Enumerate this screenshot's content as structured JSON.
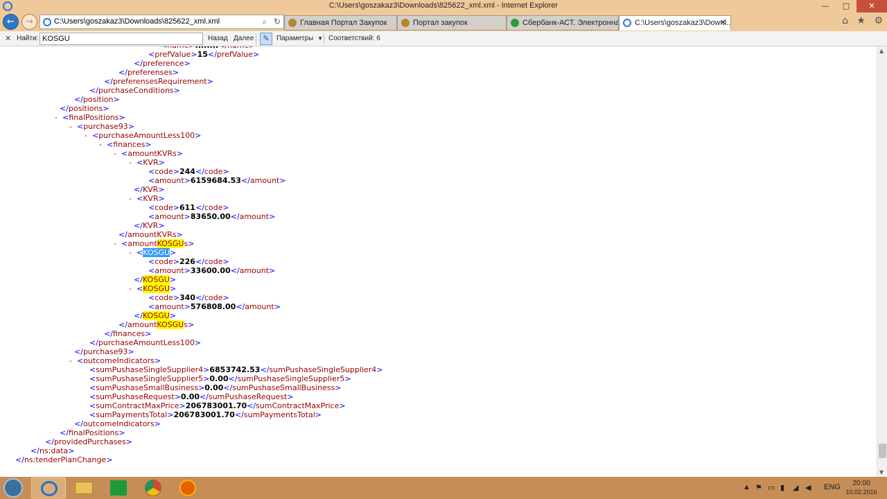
{
  "window": {
    "title": "C:\\Users\\goszakaz3\\Downloads\\825622_xml.xml - Internet Explorer",
    "minimize": "—",
    "maximize": "□",
    "close": "✕"
  },
  "navbar": {
    "back_icon": "←",
    "forward_icon": "→",
    "url": "C:\\Users\\goszakaz3\\Downloads\\825622_xml.xml",
    "search_icon": "⌕",
    "refresh_icon": "↻"
  },
  "tabs": [
    {
      "label": "Главная Портал Закупок",
      "icon": "emblem-icon",
      "color": "#b8872b",
      "active": false
    },
    {
      "label": "Портал закупок",
      "icon": "emblem-icon",
      "color": "#b8872b",
      "active": false
    },
    {
      "label": "Сбербанк-АСТ. Электронная ...",
      "icon": "sberbank-icon",
      "color": "#2a9d3a",
      "active": false
    },
    {
      "label": "C:\\Users\\goszakaz3\\Downl...",
      "icon": "ie-doc-icon",
      "color": "#2b78d4",
      "active": true,
      "close": "✕"
    }
  ],
  "toolbar_icons": {
    "home": "⌂",
    "favorites": "★",
    "settings": "⚙"
  },
  "findbar": {
    "close": "✕",
    "label": "Найти:",
    "query": "KOSGU",
    "prev": "Назад",
    "next": "Далее",
    "options": "Параметры",
    "options_arrow": "▼",
    "matches": "Соответствий: 6"
  },
  "xml_lines": [
    {
      "indent": 29,
      "html": "<span class=\"b\">&lt;</span><span class=\"t\">prefValue</span><span class=\"b\">&gt;</span><span class=\"v\">15</span><span class=\"b\">&lt;/</span><span class=\"t\">prefValue</span><span class=\"b\">&gt;</span>"
    },
    {
      "indent": 26,
      "html": "<span class=\"b\">&lt;/</span><span class=\"t\">preference</span><span class=\"b\">&gt;</span>"
    },
    {
      "indent": 23,
      "html": "<span class=\"b\">&lt;/</span><span class=\"t\">preferenses</span><span class=\"b\">&gt;</span>"
    },
    {
      "indent": 20,
      "html": "<span class=\"b\">&lt;/</span><span class=\"t\">preferensesRequirement</span><span class=\"b\">&gt;</span>"
    },
    {
      "indent": 17,
      "html": "<span class=\"b\">&lt;/</span><span class=\"t\">purchaseConditions</span><span class=\"b\">&gt;</span>"
    },
    {
      "indent": 14,
      "html": "<span class=\"b\">&lt;/</span><span class=\"t\">position</span><span class=\"b\">&gt;</span>"
    },
    {
      "indent": 11,
      "html": "<span class=\"b\">&lt;/</span><span class=\"t\">positions</span><span class=\"b\">&gt;</span>"
    },
    {
      "indent": 10,
      "html": "<span class=\"m\">-</span><span class=\"b\">&lt;</span><span class=\"t\">finalPositions</span><span class=\"b\">&gt;</span>"
    },
    {
      "indent": 13,
      "html": "<span class=\"m\">-</span><span class=\"b\">&lt;</span><span class=\"t\">purchase93</span><span class=\"b\">&gt;</span>"
    },
    {
      "indent": 16,
      "html": "<span class=\"m\">-</span><span class=\"b\">&lt;</span><span class=\"t\">purchaseAmountLess100</span><span class=\"b\">&gt;</span>"
    },
    {
      "indent": 19,
      "html": "<span class=\"m\">-</span><span class=\"b\">&lt;</span><span class=\"t\">finances</span><span class=\"b\">&gt;</span>"
    },
    {
      "indent": 22,
      "html": "<span class=\"m\">-</span><span class=\"b\">&lt;</span><span class=\"t\">amountKVRs</span><span class=\"b\">&gt;</span>"
    },
    {
      "indent": 25,
      "html": "<span class=\"m\">-</span><span class=\"b\">&lt;</span><span class=\"t\">KVR</span><span class=\"b\">&gt;</span>"
    },
    {
      "indent": 29,
      "html": "<span class=\"b\">&lt;</span><span class=\"t\">code</span><span class=\"b\">&gt;</span><span class=\"v\">244</span><span class=\"b\">&lt;/</span><span class=\"t\">code</span><span class=\"b\">&gt;</span>"
    },
    {
      "indent": 29,
      "html": "<span class=\"b\">&lt;</span><span class=\"t\">amount</span><span class=\"b\">&gt;</span><span class=\"v\">6159684.53</span><span class=\"b\">&lt;/</span><span class=\"t\">amount</span><span class=\"b\">&gt;</span>"
    },
    {
      "indent": 26,
      "html": "<span class=\"b\">&lt;/</span><span class=\"t\">KVR</span><span class=\"b\">&gt;</span>"
    },
    {
      "indent": 25,
      "html": "<span class=\"m\">-</span><span class=\"b\">&lt;</span><span class=\"t\">KVR</span><span class=\"b\">&gt;</span>"
    },
    {
      "indent": 29,
      "html": "<span class=\"b\">&lt;</span><span class=\"t\">code</span><span class=\"b\">&gt;</span><span class=\"v\">611</span><span class=\"b\">&lt;/</span><span class=\"t\">code</span><span class=\"b\">&gt;</span>"
    },
    {
      "indent": 29,
      "html": "<span class=\"b\">&lt;</span><span class=\"t\">amount</span><span class=\"b\">&gt;</span><span class=\"v\">83650.00</span><span class=\"b\">&lt;/</span><span class=\"t\">amount</span><span class=\"b\">&gt;</span>"
    },
    {
      "indent": 26,
      "html": "<span class=\"b\">&lt;/</span><span class=\"t\">KVR</span><span class=\"b\">&gt;</span>"
    },
    {
      "indent": 23,
      "html": "<span class=\"b\">&lt;/</span><span class=\"t\">amountKVRs</span><span class=\"b\">&gt;</span>"
    },
    {
      "indent": 22,
      "html": "<span class=\"m\">-</span><span class=\"b\">&lt;</span><span class=\"t\">amount<span class=\"hl\">KOSGU</span>s</span><span class=\"b\">&gt;</span>"
    },
    {
      "indent": 25,
      "html": "<span class=\"m\">-</span><span class=\"b\">&lt;</span><span class=\"t sel\">KOSGU</span><span class=\"b\">&gt;</span>"
    },
    {
      "indent": 29,
      "html": "<span class=\"b\">&lt;</span><span class=\"t\">code</span><span class=\"b\">&gt;</span><span class=\"v\">226</span><span class=\"b\">&lt;/</span><span class=\"t\">code</span><span class=\"b\">&gt;</span>"
    },
    {
      "indent": 29,
      "html": "<span class=\"b\">&lt;</span><span class=\"t\">amount</span><span class=\"b\">&gt;</span><span class=\"v\">33600.00</span><span class=\"b\">&lt;/</span><span class=\"t\">amount</span><span class=\"b\">&gt;</span>"
    },
    {
      "indent": 26,
      "html": "<span class=\"b\">&lt;/</span><span class=\"t hl\">KOSGU</span><span class=\"b\">&gt;</span>"
    },
    {
      "indent": 25,
      "html": "<span class=\"m\">-</span><span class=\"b\">&lt;</span><span class=\"t hl\">KOSGU</span><span class=\"b\">&gt;</span>"
    },
    {
      "indent": 29,
      "html": "<span class=\"b\">&lt;</span><span class=\"t\">code</span><span class=\"b\">&gt;</span><span class=\"v\">340</span><span class=\"b\">&lt;/</span><span class=\"t\">code</span><span class=\"b\">&gt;</span>"
    },
    {
      "indent": 29,
      "html": "<span class=\"b\">&lt;</span><span class=\"t\">amount</span><span class=\"b\">&gt;</span><span class=\"v\">576808.00</span><span class=\"b\">&lt;/</span><span class=\"t\">amount</span><span class=\"b\">&gt;</span>"
    },
    {
      "indent": 26,
      "html": "<span class=\"b\">&lt;/</span><span class=\"t hl\">KOSGU</span><span class=\"b\">&gt;</span>"
    },
    {
      "indent": 23,
      "html": "<span class=\"b\">&lt;/</span><span class=\"t\">amount<span class=\"hl\">KOSGU</span>s</span><span class=\"b\">&gt;</span>"
    },
    {
      "indent": 20,
      "html": "<span class=\"b\">&lt;/</span><span class=\"t\">finances</span><span class=\"b\">&gt;</span>"
    },
    {
      "indent": 17,
      "html": "<span class=\"b\">&lt;/</span><span class=\"t\">purchaseAmountLess100</span><span class=\"b\">&gt;</span>"
    },
    {
      "indent": 14,
      "html": "<span class=\"b\">&lt;/</span><span class=\"t\">purchase93</span><span class=\"b\">&gt;</span>"
    },
    {
      "indent": 13,
      "html": "<span class=\"m\">-</span><span class=\"b\">&lt;</span><span class=\"t\">outcomeIndicators</span><span class=\"b\">&gt;</span>"
    },
    {
      "indent": 17,
      "html": "<span class=\"b\">&lt;</span><span class=\"t\">sumPushaseSingleSupplier4</span><span class=\"b\">&gt;</span><span class=\"v\">6853742.53</span><span class=\"b\">&lt;/</span><span class=\"t\">sumPushaseSingleSupplier4</span><span class=\"b\">&gt;</span>"
    },
    {
      "indent": 17,
      "html": "<span class=\"b\">&lt;</span><span class=\"t\">sumPushaseSingleSupplier5</span><span class=\"b\">&gt;</span><span class=\"v\">0.00</span><span class=\"b\">&lt;/</span><span class=\"t\">sumPushaseSingleSupplier5</span><span class=\"b\">&gt;</span>"
    },
    {
      "indent": 17,
      "html": "<span class=\"b\">&lt;</span><span class=\"t\">sumPushaseSmallBusiness</span><span class=\"b\">&gt;</span><span class=\"v\">0.00</span><span class=\"b\">&lt;/</span><span class=\"t\">sumPushaseSmallBusiness</span><span class=\"b\">&gt;</span>"
    },
    {
      "indent": 17,
      "html": "<span class=\"b\">&lt;</span><span class=\"t\">sumPushaseRequest</span><span class=\"b\">&gt;</span><span class=\"v\">0.00</span><span class=\"b\">&lt;/</span><span class=\"t\">sumPushaseRequest</span><span class=\"b\">&gt;</span>"
    },
    {
      "indent": 17,
      "html": "<span class=\"b\">&lt;</span><span class=\"t\">sumContractMaxPrice</span><span class=\"b\">&gt;</span><span class=\"v\">206783001.70</span><span class=\"b\">&lt;/</span><span class=\"t\">sumContractMaxPrice</span><span class=\"b\">&gt;</span>"
    },
    {
      "indent": 17,
      "html": "<span class=\"b\">&lt;</span><span class=\"t\">sumPaymentsTotal</span><span class=\"b\">&gt;</span><span class=\"v\">206783001.70</span><span class=\"b\">&lt;/</span><span class=\"t\">sumPaymentsTotal</span><span class=\"b\">&gt;</span>"
    },
    {
      "indent": 14,
      "html": "<span class=\"b\">&lt;/</span><span class=\"t\">outcomeIndicators</span><span class=\"b\">&gt;</span>"
    },
    {
      "indent": 11,
      "html": "<span class=\"b\">&lt;/</span><span class=\"t\">finalPositions</span><span class=\"b\">&gt;</span>"
    },
    {
      "indent": 8,
      "html": "<span class=\"b\">&lt;/</span><span class=\"t\">providedPurchases</span><span class=\"b\">&gt;</span>"
    },
    {
      "indent": 5,
      "html": "<span class=\"b\">&lt;/</span><span class=\"t\">ns:data</span><span class=\"b\">&gt;</span>"
    },
    {
      "indent": 2,
      "html": "<span class=\"b\">&lt;/</span><span class=\"t\">ns:tenderPlanChange</span><span class=\"b\">&gt;</span>"
    }
  ],
  "taskbar": {
    "apps": [
      "internet-explorer-icon",
      "file-explorer-icon",
      "store-icon",
      "chrome-icon",
      "firefox-icon"
    ],
    "tray_language": "ENG",
    "time": "20:00",
    "date": "10.02.2016"
  }
}
